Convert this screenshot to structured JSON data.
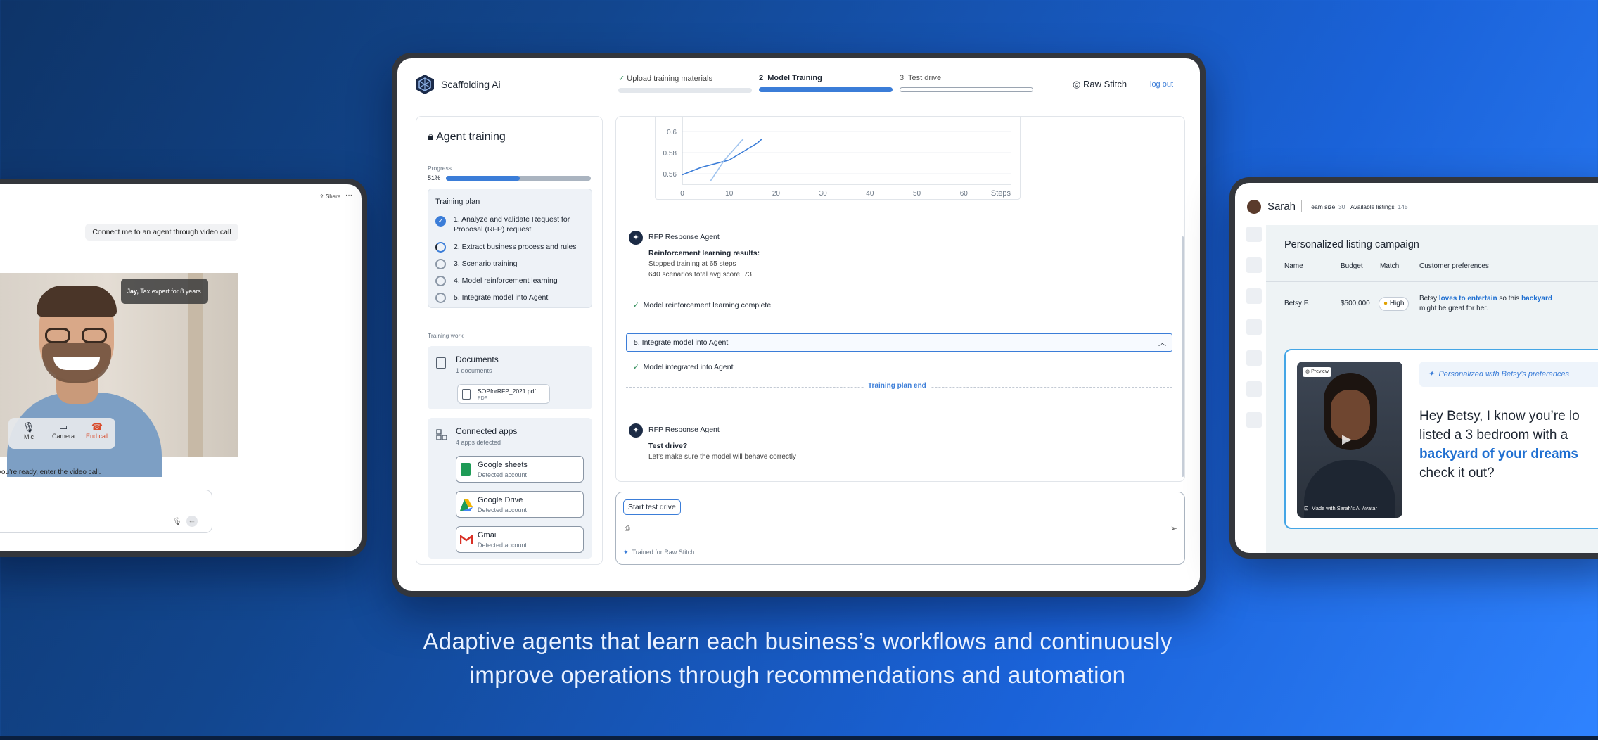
{
  "tagline": {
    "line1": "Adaptive agents that learn each business’s workflows and continuously",
    "line2": "improve operations through recommendations and automation"
  },
  "left": {
    "share": "Share",
    "more": "···",
    "request": "Connect me to an agent through video call",
    "agent_name": "Jay,",
    "agent_role": "Tax expert for 8 years",
    "controls": {
      "mic": "Mic",
      "camera": "Camera",
      "end": "End call"
    },
    "prompt": "When you’re ready, enter the video call."
  },
  "main": {
    "brand": "Scaffolding Ai",
    "steps": [
      {
        "num": "",
        "label": "Upload training materials",
        "progress": 1
      },
      {
        "num": "2",
        "label": "Model Training",
        "progress": 1
      },
      {
        "num": "3",
        "label": "Test drive",
        "progress": 0
      }
    ],
    "user": "Raw Stitch",
    "logout": "log out",
    "sidebar": {
      "title": "Agent training",
      "progress_label": "Progress",
      "progress_value": "51%",
      "progress_fraction": 0.51,
      "plan_title": "Training plan",
      "plan_items": [
        {
          "label": "1.  Analyze and validate Request for Proposal (RFP) request",
          "state": "done"
        },
        {
          "label": "2. Extract business process and rules",
          "state": "active"
        },
        {
          "label": "3. Scenario training",
          "state": "todo"
        },
        {
          "label": "4. Model reinforcement learning",
          "state": "todo"
        },
        {
          "label": "5. Integrate model into Agent",
          "state": "todo"
        }
      ],
      "work_label": "Training work",
      "docs": {
        "title": "Documents",
        "count": "1 documents",
        "file": "SOPforRFP_2021.pdf",
        "type": "PDF"
      },
      "apps": {
        "title": "Connected apps",
        "count": "4 apps detected",
        "items": [
          {
            "name": "Google sheets",
            "status": "Detected account",
            "color": "#1e9b56"
          },
          {
            "name": "Google Drive",
            "status": "Detected account",
            "color": "#f4b400"
          },
          {
            "name": "Gmail",
            "status": "Detected account",
            "color": "#d93025"
          }
        ]
      }
    },
    "chart_data": {
      "type": "line",
      "xlabel": "Steps",
      "x_ticks": [
        "0",
        "10",
        "20",
        "30",
        "40",
        "50",
        "60"
      ],
      "y_ticks": [
        "0.6",
        "0.58",
        "0.56"
      ],
      "ylim": [
        0.55,
        0.62
      ],
      "xlim": [
        0,
        70
      ],
      "series": [
        {
          "values": [
            [
              0,
              0.559
            ],
            [
              4,
              0.566
            ],
            [
              10,
              0.573
            ],
            [
              16,
              0.589
            ],
            [
              17,
              0.593
            ]
          ],
          "color": "#3b7dd8"
        },
        {
          "values": [
            [
              6,
              0.553
            ],
            [
              9,
              0.573
            ],
            [
              13,
              0.593
            ]
          ],
          "color": "#9fc3ee"
        }
      ]
    },
    "msg1": {
      "agent": "RFP Response Agent",
      "heading": "Reinforcement learning results:",
      "line1": "Stopped training at 65 steps",
      "line2": "640 scenarios total avg score: 73"
    },
    "complete": "Model reinforcement learning complete",
    "step5": "5.  Integrate model into Agent",
    "integrated": "Model integrated into Agent",
    "plan_end": "Training plan end",
    "msg2": {
      "agent": "RFP Response Agent",
      "heading": "Test drive?",
      "line1": "Let’s make sure the model will behave correctly"
    },
    "test_button": "Start test drive",
    "trained_for": "Trained for Raw Stitch"
  },
  "right": {
    "name": "Sarah",
    "team_label": "Team size",
    "team_value": "30",
    "listings_label": "Available listings",
    "listings_value": "145",
    "campaign": "Personalized listing campaign",
    "columns": [
      "Name",
      "Budget",
      "Match",
      "Customer preferences"
    ],
    "row": {
      "name": "Betsy F.",
      "budget": "$500,000",
      "match": "High",
      "pref_pre": "Betsy ",
      "pref_bold": "loves to entertain",
      "pref_mid": " so this ",
      "pref_bold2": "backyard",
      "pref_post": "might be great for her."
    },
    "preview": "Preview",
    "made_with": "Made with Sarah’s AI Avatar",
    "personalized": "Personalized with Betsy’s preferences",
    "message": {
      "l1": "Hey Betsy, I know you’re lo",
      "l2": "listed a 3 bedroom with a",
      "l3": "backyard of your dreams",
      "l4": "check it out?"
    }
  }
}
